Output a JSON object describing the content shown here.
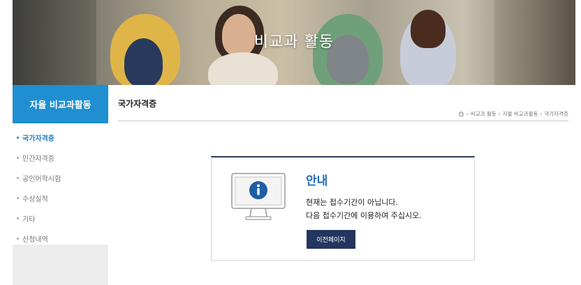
{
  "hero": {
    "title": "비교과 활동"
  },
  "sidebar": {
    "title": "자율 비교과활동",
    "items": [
      {
        "label": "국가자격증",
        "active": true
      },
      {
        "label": "민간자격증",
        "active": false
      },
      {
        "label": "공인어학시험",
        "active": false
      },
      {
        "label": "수상실적",
        "active": false
      },
      {
        "label": "기타",
        "active": false
      },
      {
        "label": "신청내역",
        "active": false
      }
    ]
  },
  "main": {
    "page_title": "국가자격증",
    "breadcrumb": [
      {
        "icon": "home-icon"
      },
      {
        "label": "비교과 활동"
      },
      {
        "label": "자율 비교과활동"
      },
      {
        "label": "국가자격증"
      }
    ],
    "breadcrumb_separator": "›"
  },
  "notice": {
    "icon": "info-monitor-icon",
    "heading": "안내",
    "line1": "현재는 접수기간이 아닙니다.",
    "line2": "다음 접수기간에 이용하여 주십시오.",
    "button_label": "이전페이지"
  },
  "colors": {
    "accent": "#1f8fd2",
    "button": "#233660",
    "heading": "#1f6fb5"
  }
}
